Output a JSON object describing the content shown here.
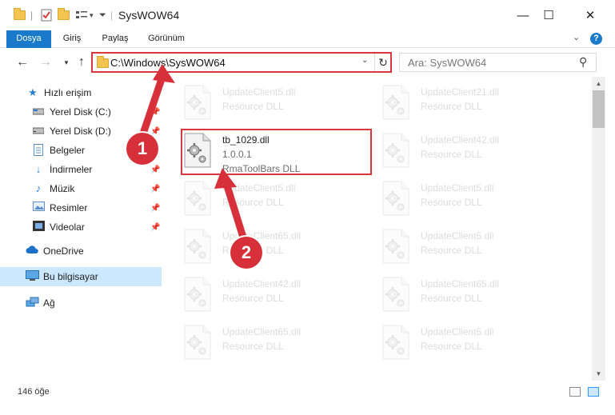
{
  "window": {
    "title": "SysWOW64",
    "minimize_glyph": "—",
    "maximize_glyph": "☐",
    "close_glyph": "✕"
  },
  "ribbon": {
    "tabs": [
      "Dosya",
      "Giriş",
      "Paylaş",
      "Görünüm"
    ],
    "help_glyph": "?"
  },
  "nav": {
    "address": "C:\\Windows\\SysWOW64",
    "search_placeholder": "Ara: SysWOW64"
  },
  "sidebar": {
    "items": [
      {
        "label": "Hızlı erişim",
        "icon": "star-icon"
      },
      {
        "label": "Yerel Disk (C:)",
        "icon": "drive-icon"
      },
      {
        "label": "Yerel Disk (D:)",
        "icon": "drive-icon"
      },
      {
        "label": "Belgeler",
        "icon": "documents-icon"
      },
      {
        "label": "İndirmeler",
        "icon": "download-icon"
      },
      {
        "label": "Müzik",
        "icon": "music-icon"
      },
      {
        "label": "Resimler",
        "icon": "pictures-icon"
      },
      {
        "label": "Videolar",
        "icon": "video-icon"
      },
      {
        "label": "OneDrive",
        "icon": "cloud-icon"
      },
      {
        "label": "Bu bilgisayar",
        "icon": "computer-icon"
      },
      {
        "label": "Ağ",
        "icon": "network-icon"
      }
    ]
  },
  "files": [
    {
      "name": "UpdateClient5.dll",
      "desc": "Resource DLL",
      "version": ""
    },
    {
      "name": "UpdateClient21.dll",
      "desc": "Resource DLL",
      "version": ""
    },
    {
      "name": "tb_1029.dll",
      "version": "1.0.0.1",
      "desc": "RmaToolBars DLL"
    },
    {
      "name": "UpdateClient42.dll",
      "desc": "Resource DLL",
      "version": ""
    },
    {
      "name": "UpdateClient5.dll",
      "desc": "Resource DLL",
      "version": ""
    },
    {
      "name": "UpdateClient5.dll",
      "desc": "Resource DLL",
      "version": ""
    },
    {
      "name": "UpdateClient65.dll",
      "desc": "Resource DLL",
      "version": ""
    },
    {
      "name": "UpdateClient5.dll",
      "desc": "Resource DLL",
      "version": ""
    },
    {
      "name": "UpdateClient42.dll",
      "desc": "Resource DLL",
      "version": ""
    },
    {
      "name": "UpdateClient65.dll",
      "desc": "Resource DLL",
      "version": ""
    },
    {
      "name": "UpdateClient65.dll",
      "desc": "Resource DLL",
      "version": ""
    },
    {
      "name": "UpdateClient5.dll",
      "desc": "Resource DLL",
      "version": ""
    }
  ],
  "status": {
    "count": "146 öğe"
  },
  "callouts": [
    "1",
    "2"
  ],
  "colors": {
    "accent": "#1979ca",
    "highlight": "#d9363e",
    "selected_bg": "#cce8ff"
  }
}
